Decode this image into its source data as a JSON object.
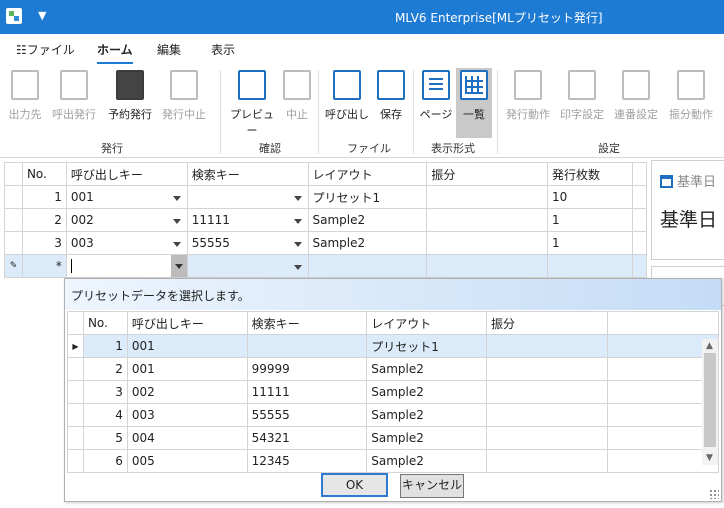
{
  "window": {
    "title": "MLV6 Enterprise[MLプリセット発行]"
  },
  "menu": {
    "items": [
      {
        "label": "ファイル"
      },
      {
        "label": "ホーム"
      },
      {
        "label": "編集"
      },
      {
        "label": "表示"
      }
    ]
  },
  "ribbon": {
    "buttons": [
      {
        "label": "出力先"
      },
      {
        "label": "呼出発行"
      },
      {
        "label": "予約発行"
      },
      {
        "label": "発行中止"
      },
      {
        "label": "プレビュー"
      },
      {
        "label": "中止"
      },
      {
        "label": "呼び出し"
      },
      {
        "label": "保存"
      },
      {
        "label": "ページ"
      },
      {
        "label": "一覧"
      },
      {
        "label": "発行動作"
      },
      {
        "label": "印字設定"
      },
      {
        "label": "連番設定"
      },
      {
        "label": "振分動作"
      }
    ],
    "groups": [
      {
        "label": "発行"
      },
      {
        "label": "確認"
      },
      {
        "label": "ファイル"
      },
      {
        "label": "表示形式"
      },
      {
        "label": "設定"
      }
    ]
  },
  "main_grid": {
    "headers": [
      "No.",
      "呼び出しキー",
      "検索キー",
      "レイアウト",
      "振分",
      "発行枚数"
    ],
    "rows": [
      {
        "no": "1",
        "key": "001",
        "search": "",
        "layout": "プリセット1",
        "sort": "",
        "count": "10"
      },
      {
        "no": "2",
        "key": "002",
        "search": "11111",
        "layout": "Sample2",
        "sort": "",
        "count": "1"
      },
      {
        "no": "3",
        "key": "003",
        "search": "55555",
        "layout": "Sample2",
        "sort": "",
        "count": "1"
      }
    ],
    "new_row_marker": "*"
  },
  "right_panel": {
    "title": "基準日",
    "value": "基準日"
  },
  "popup": {
    "message": "プリセットデータを選択します。",
    "headers": [
      "No.",
      "呼び出しキー",
      "検索キー",
      "レイアウト",
      "振分"
    ],
    "rows": [
      {
        "no": "1",
        "key": "001",
        "search": "",
        "layout": "プリセット1",
        "sort": ""
      },
      {
        "no": "2",
        "key": "001",
        "search": "99999",
        "layout": "Sample2",
        "sort": ""
      },
      {
        "no": "3",
        "key": "002",
        "search": "11111",
        "layout": "Sample2",
        "sort": ""
      },
      {
        "no": "4",
        "key": "003",
        "search": "55555",
        "layout": "Sample2",
        "sort": ""
      },
      {
        "no": "5",
        "key": "004",
        "search": "54321",
        "layout": "Sample2",
        "sort": ""
      },
      {
        "no": "6",
        "key": "005",
        "search": "12345",
        "layout": "Sample2",
        "sort": ""
      }
    ],
    "ok_label": "OK",
    "cancel_label": "キャンセル"
  }
}
